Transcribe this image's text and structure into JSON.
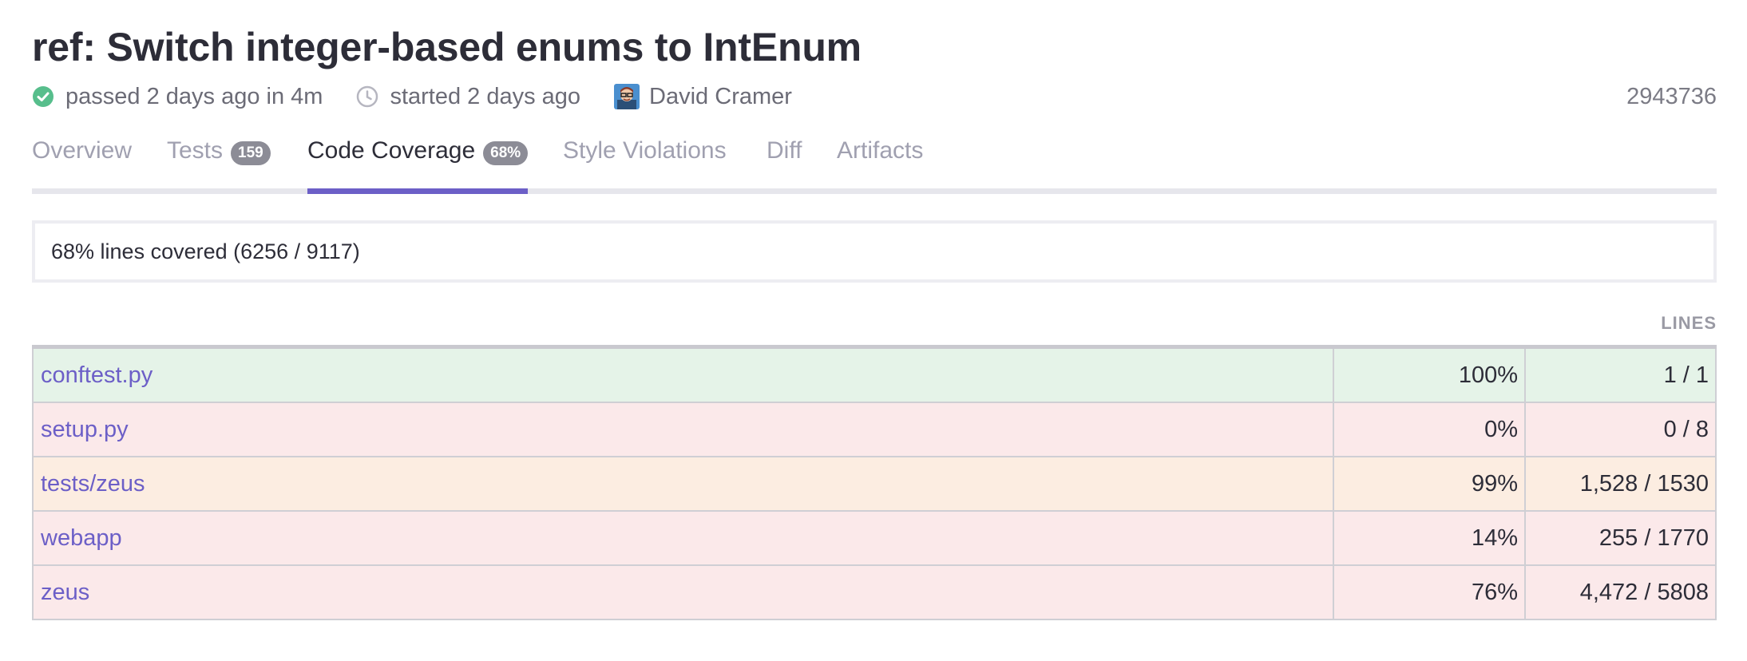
{
  "build": {
    "title": "ref: Switch integer-based enums to IntEnum",
    "status_text": "passed 2 days ago in 4m",
    "started_text": "started 2 days ago",
    "author": "David Cramer",
    "build_id": "2943736",
    "status_icon": "check-circle-icon",
    "clock_icon": "clock-icon"
  },
  "tabs": [
    {
      "label": "Overview",
      "badge": null,
      "active": false
    },
    {
      "label": "Tests",
      "badge": "159",
      "active": false
    },
    {
      "label": "Code Coverage",
      "badge": "68%",
      "active": true
    },
    {
      "label": "Style Violations",
      "badge": null,
      "active": false
    },
    {
      "label": "Diff",
      "badge": null,
      "active": false
    },
    {
      "label": "Artifacts",
      "badge": null,
      "active": false
    }
  ],
  "coverage": {
    "summary": "68% lines covered (6256 / 9117)",
    "lines_header": "LINES",
    "rows": [
      {
        "name": "conftest.py",
        "percent": "100%",
        "lines": "1 / 1",
        "status": "good"
      },
      {
        "name": "setup.py",
        "percent": "0%",
        "lines": "0 / 8",
        "status": "bad"
      },
      {
        "name": "tests/zeus",
        "percent": "99%",
        "lines": "1,528 / 1530",
        "status": "warn"
      },
      {
        "name": "webapp",
        "percent": "14%",
        "lines": "255 / 1770",
        "status": "bad"
      },
      {
        "name": "zeus",
        "percent": "76%",
        "lines": "4,472 / 5808",
        "status": "bad"
      }
    ]
  },
  "colors": {
    "accent": "#6c5fc7",
    "success": "#57be8c",
    "row_good": "#e5f3e8",
    "row_bad": "#fbe9ea",
    "row_warn": "#fcede1"
  }
}
